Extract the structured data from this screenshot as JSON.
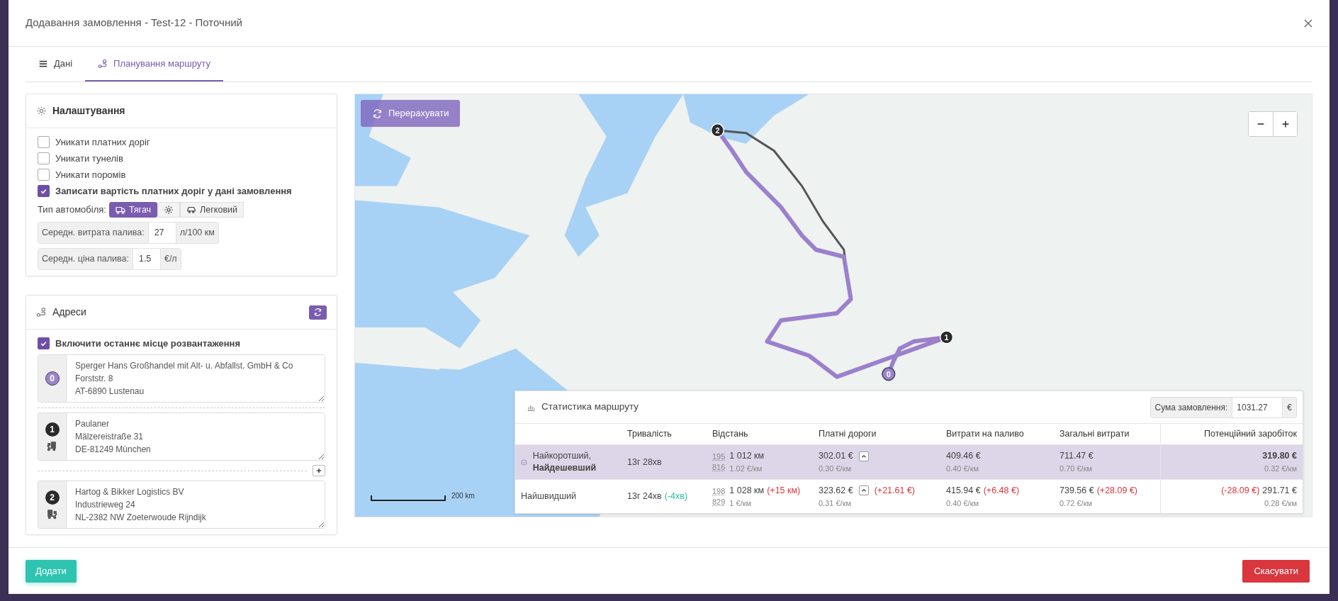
{
  "window": {
    "title": "Додавання замовлення - Test-12 - Поточний"
  },
  "tabs": [
    {
      "label": "Дані",
      "selected": false
    },
    {
      "label": "Планування маршруту",
      "selected": true
    }
  ],
  "settings": {
    "title": "Налаштування",
    "options": [
      {
        "label": "Уникати платних доріг",
        "checked": false
      },
      {
        "label": "Уникати тунелів",
        "checked": false
      },
      {
        "label": "Уникати поромів",
        "checked": false
      },
      {
        "label": "Записати вартість платних доріг у дані замовлення",
        "checked": true
      }
    ],
    "vehicle": {
      "label": "Тип автомобіля:",
      "options": [
        {
          "kind": "truck",
          "label": "Тягач",
          "selected": true
        },
        {
          "kind": "settings",
          "selected": false
        },
        {
          "kind": "car",
          "label": "Легковий",
          "selected": false
        }
      ]
    },
    "fields": [
      {
        "label": "Середн. витрата палива:",
        "value": "27",
        "unit": "л/100 км"
      },
      {
        "label": "Середн. ціна палива:",
        "value": "1.5",
        "unit": "€/л"
      }
    ]
  },
  "addresses": {
    "title": "Адреси",
    "include_last": {
      "label": "Включити останнє місце розвантаження",
      "checked": true
    },
    "stops": [
      {
        "number": "0",
        "kind": "origin",
        "lines": [
          "Sperger Hans Großhandel mit Alt- u. Abfallst. GmbH & Co",
          "Forststr. 8",
          "AT-6890 Lustenau"
        ]
      },
      {
        "number": "1",
        "kind": "unload",
        "lines": [
          "Paulaner",
          "Mälzereistraße 31",
          "DE-81249 München"
        ]
      },
      {
        "number": "2",
        "kind": "load",
        "lines": [
          "Hartog & Bikker Logistics BV",
          "Industrieweg 24",
          "NL-2382 NW Zoeterwoude Rijndijk"
        ]
      }
    ]
  },
  "map": {
    "recalc_button": "Перерахувати",
    "scale": "200 km",
    "markers": [
      {
        "number": "2",
        "kind": "dark"
      },
      {
        "number": "1",
        "kind": "dark"
      },
      {
        "number": "0",
        "kind": "origin"
      }
    ]
  },
  "route_stats": {
    "title": "Статистика маршруту",
    "order_sum": {
      "label": "Сума замовлення:",
      "value": "1031.27",
      "unit": "€"
    },
    "columns": [
      "Тривалість",
      "Відстань",
      "Платні дороги",
      "Витрати на паливо",
      "Загальні витрати",
      "Потенційний заробіток"
    ],
    "rows": [
      {
        "selected": true,
        "name": "Найкоротший, **Найдешевший**",
        "duration": {
          "value": "13г 28хв"
        },
        "distance": {
          "codes": [
            "195",
            "816"
          ],
          "value": "1 012 км",
          "per_km": "1.02 €/км"
        },
        "tolls": {
          "value": "302.01 €",
          "per_km": "0.30 €/км"
        },
        "fuel": {
          "value": "409.46 €",
          "per_km": "0.40 €/км"
        },
        "total": {
          "value": "711.47 €",
          "per_km": "0.70 €/км"
        },
        "profit": {
          "value": "319.80 €",
          "per_km": "0.32 €/км"
        }
      },
      {
        "selected": false,
        "name": "Найшвидший",
        "duration": {
          "value": "13г 24хв",
          "diff": {
            "text": "(-4хв)",
            "color": "#2bbfa6"
          }
        },
        "distance": {
          "codes": [
            "198",
            "829"
          ],
          "value": "1 028 км",
          "diff": {
            "text": "(+15 км)",
            "color": "#d9363e"
          },
          "per_km": "1 €/км"
        },
        "tolls": {
          "value": "323.62 €",
          "diff": {
            "text": "(+21.61 €)",
            "color": "#d9363e"
          },
          "per_km": "0.31 €/км"
        },
        "fuel": {
          "value": "415.94 €",
          "diff": {
            "text": "(+6.48 €)",
            "color": "#d9363e"
          },
          "per_km": "0.40 €/км"
        },
        "total": {
          "value": "739.56 €",
          "diff": {
            "text": "(+28.09 €)",
            "color": "#d9363e"
          },
          "per_km": "0.72 €/км"
        },
        "profit": {
          "value": "291.71 €",
          "diff": {
            "text": "(-28.09 €)",
            "color": "#d9363e"
          },
          "per_km": "0.28 €/км"
        }
      }
    ]
  },
  "footer": {
    "submit": "Додати",
    "cancel": "Скасувати"
  }
}
